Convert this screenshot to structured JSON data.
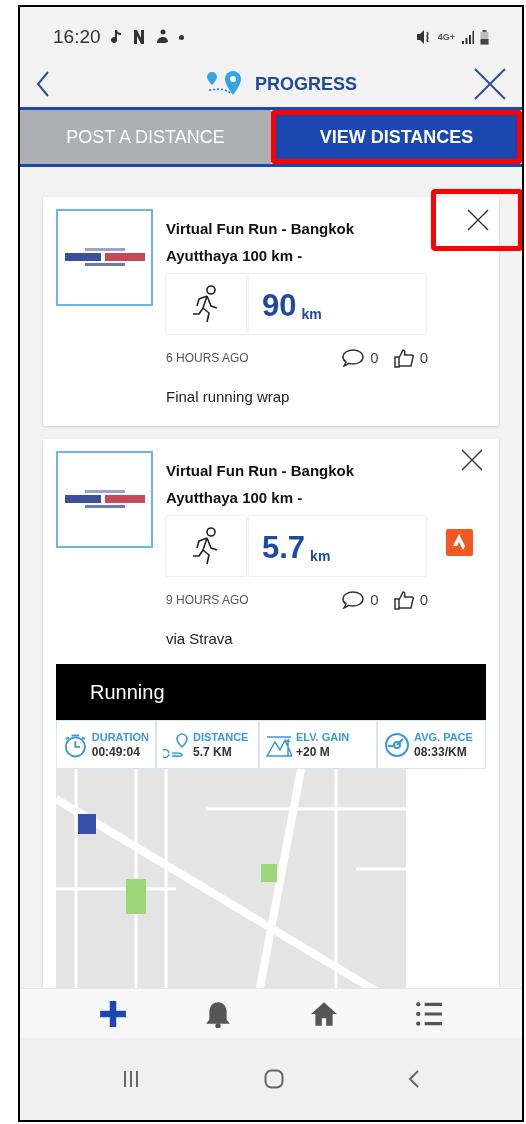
{
  "status_bar": {
    "time": "16:20",
    "network": "4G+"
  },
  "header": {
    "title": "PROGRESS"
  },
  "tabs": [
    {
      "label": "POST A DISTANCE",
      "selected": false,
      "highlighted": false
    },
    {
      "label": "VIEW DISTANCES",
      "selected": true,
      "highlighted": true
    }
  ],
  "posts": [
    {
      "title": "Virtual Fun Run - Bangkok Ayutthaya 100 km -",
      "distance": "90",
      "unit": "km",
      "time": "6 HOURS AGO",
      "comments": "0",
      "likes": "0",
      "note": "Final running wrap",
      "close_highlighted": true,
      "kind": "manual"
    },
    {
      "title": "Virtual Fun Run - Bangkok Ayutthaya 100 km -",
      "distance": "5.7",
      "unit": "km",
      "time": "9 HOURS AGO",
      "comments": "0",
      "likes": "0",
      "note": "via Strava",
      "close_highlighted": false,
      "kind": "strava",
      "activity": {
        "title": "Running",
        "stats": [
          {
            "kind": "duration",
            "label": "DURATION",
            "value": "00:49:04"
          },
          {
            "kind": "distance",
            "label": "DISTANCE",
            "value": "5.7 KM"
          },
          {
            "kind": "elevation",
            "label": "ELV. GAIN",
            "value": "+20 M"
          },
          {
            "kind": "pace",
            "label": "AVG. PACE",
            "value": "08:33/KM"
          }
        ]
      }
    }
  ],
  "bottom_nav": [
    {
      "kind": "add",
      "selected": true
    },
    {
      "kind": "bell",
      "selected": false
    },
    {
      "kind": "home",
      "selected": false
    },
    {
      "kind": "list",
      "selected": false
    }
  ]
}
